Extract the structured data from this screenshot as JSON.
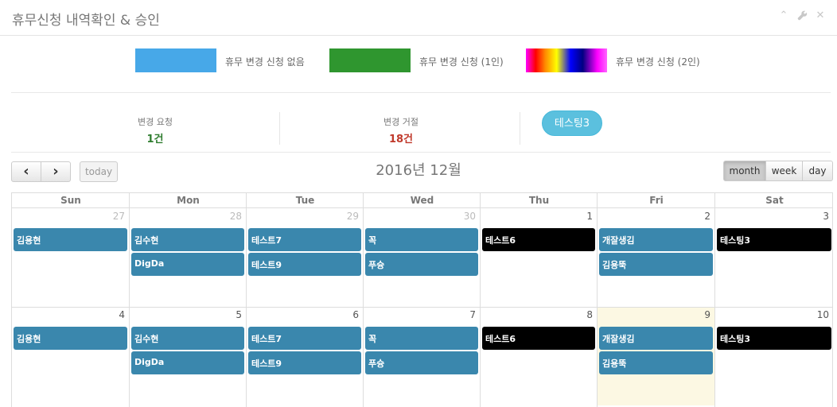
{
  "header": {
    "title": "휴무신청 내역확인 & 승인"
  },
  "tools": [
    {
      "name": "collapse-icon",
      "glyph": "⌃"
    },
    {
      "name": "wrench-icon",
      "glyph": "🔧"
    },
    {
      "name": "close-icon",
      "glyph": "✕"
    }
  ],
  "legend": [
    {
      "label": "휴무 변경 신청 없음",
      "color": "#47a8e8"
    },
    {
      "label": "휴무 변경 신청 (1인)",
      "color": "#2f962f"
    },
    {
      "label": "휴무 변경 신청 (2인)",
      "color": "rainbow"
    }
  ],
  "stats": {
    "request_label": "변경 요청",
    "request_value": "1건",
    "request_color": "#2f7d2f",
    "reject_label": "변경 거절",
    "reject_value": "18건",
    "reject_color": "#c0392b",
    "user_pill": "테스팅3"
  },
  "toolbar": {
    "prev_glyph": "‹",
    "next_glyph": "›",
    "today_label": "today",
    "title": "2016년 12월",
    "views": [
      "month",
      "week",
      "day"
    ],
    "active_view": "month"
  },
  "calendar": {
    "days_of_week": [
      "Sun",
      "Mon",
      "Tue",
      "Wed",
      "Thu",
      "Fri",
      "Sat"
    ],
    "today_color": "#fcf8e3",
    "weeks": [
      {
        "days": [
          {
            "num": "27",
            "other": true
          },
          {
            "num": "28",
            "other": true
          },
          {
            "num": "29",
            "other": true
          },
          {
            "num": "30",
            "other": true
          },
          {
            "num": "1",
            "other": false
          },
          {
            "num": "2",
            "other": false
          },
          {
            "num": "3",
            "other": false
          }
        ],
        "events": [
          {
            "title": "김용현",
            "day": 0,
            "slot": 0,
            "color": "#3a87ad"
          },
          {
            "title": "김수현",
            "day": 1,
            "slot": 0,
            "color": "#3a87ad"
          },
          {
            "title": "DigDa",
            "day": 1,
            "slot": 1,
            "color": "#3a87ad"
          },
          {
            "title": "테스트7",
            "day": 2,
            "slot": 0,
            "color": "#3a87ad"
          },
          {
            "title": "테스트9",
            "day": 2,
            "slot": 1,
            "color": "#3a87ad"
          },
          {
            "title": "꼭",
            "day": 3,
            "slot": 0,
            "color": "#3a87ad"
          },
          {
            "title": "푸슝",
            "day": 3,
            "slot": 1,
            "color": "#3a87ad"
          },
          {
            "title": "테스트6",
            "day": 4,
            "slot": 0,
            "color": "#000000"
          },
          {
            "title": "개잘생김",
            "day": 5,
            "slot": 0,
            "color": "#3a87ad"
          },
          {
            "title": "김용뚝",
            "day": 5,
            "slot": 1,
            "color": "#3a87ad"
          },
          {
            "title": "테스팅3",
            "day": 6,
            "slot": 0,
            "color": "#000000"
          }
        ]
      },
      {
        "days": [
          {
            "num": "4",
            "other": false
          },
          {
            "num": "5",
            "other": false
          },
          {
            "num": "6",
            "other": false
          },
          {
            "num": "7",
            "other": false
          },
          {
            "num": "8",
            "other": false
          },
          {
            "num": "9",
            "other": false,
            "today": true
          },
          {
            "num": "10",
            "other": false
          }
        ],
        "events": [
          {
            "title": "김용현",
            "day": 0,
            "slot": 0,
            "color": "#3a87ad"
          },
          {
            "title": "김수현",
            "day": 1,
            "slot": 0,
            "color": "#3a87ad"
          },
          {
            "title": "DigDa",
            "day": 1,
            "slot": 1,
            "color": "#3a87ad"
          },
          {
            "title": "테스트7",
            "day": 2,
            "slot": 0,
            "color": "#3a87ad"
          },
          {
            "title": "테스트9",
            "day": 2,
            "slot": 1,
            "color": "#3a87ad"
          },
          {
            "title": "꼭",
            "day": 3,
            "slot": 0,
            "color": "#3a87ad"
          },
          {
            "title": "푸슝",
            "day": 3,
            "slot": 1,
            "color": "#3a87ad"
          },
          {
            "title": "테스트6",
            "day": 4,
            "slot": 0,
            "color": "#000000"
          },
          {
            "title": "개잘생김",
            "day": 5,
            "slot": 0,
            "color": "#3a87ad"
          },
          {
            "title": "김용뚝",
            "day": 5,
            "slot": 1,
            "color": "#3a87ad"
          },
          {
            "title": "테스팅3",
            "day": 6,
            "slot": 0,
            "color": "#000000"
          }
        ]
      }
    ]
  }
}
